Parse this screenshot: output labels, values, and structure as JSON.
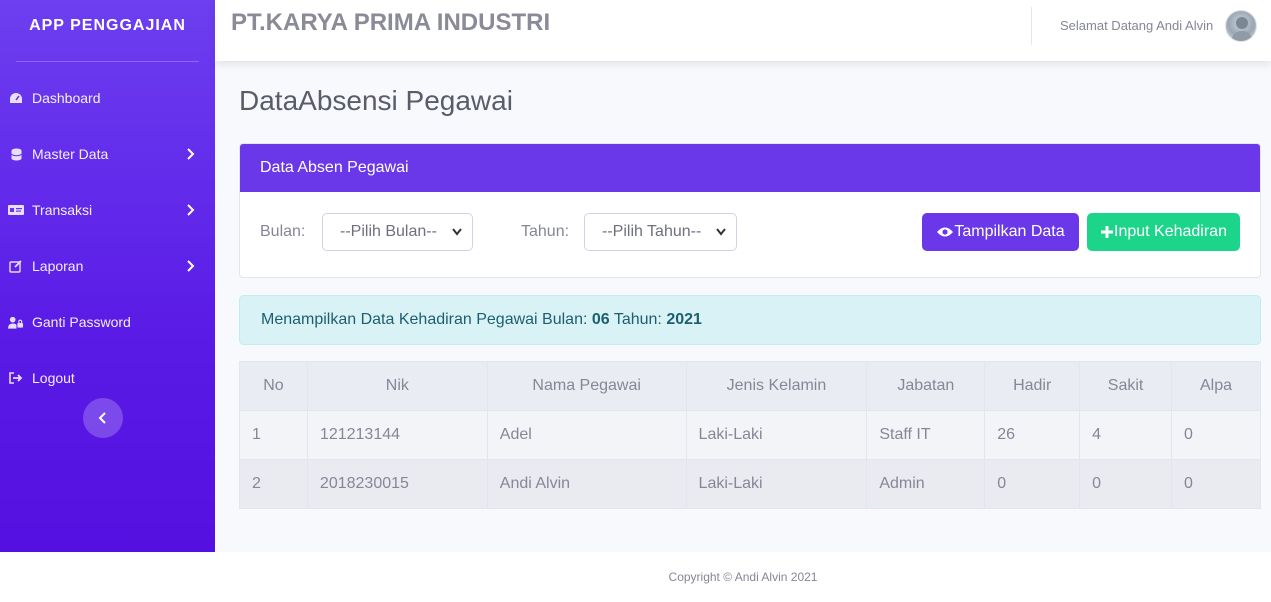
{
  "sidebar": {
    "brand": "APP PENGGAJIAN",
    "items": [
      {
        "label": "Dashboard",
        "icon": "tachometer-icon"
      },
      {
        "label": "Master Data",
        "icon": "database-icon"
      },
      {
        "label": "Transaksi",
        "icon": "id-card-icon"
      },
      {
        "label": "Laporan",
        "icon": "edit-icon"
      },
      {
        "label": "Ganti Password",
        "icon": "user-lock-icon"
      },
      {
        "label": "Logout",
        "icon": "sign-out-icon"
      }
    ]
  },
  "topbar": {
    "company": "PT.KARYA PRIMA INDUSTRI",
    "welcome": "Selamat Datang Andi Alvin"
  },
  "page": {
    "title": "DataAbsensi Pegawai"
  },
  "filter_card": {
    "header": "Data Absen Pegawai",
    "bulan_label": "Bulan:",
    "bulan_value": "--Pilih Bulan--",
    "tahun_label": "Tahun:",
    "tahun_value": "--Pilih Tahun--",
    "show_button": "Tampilkan Data",
    "input_button": "Input Kehadiran"
  },
  "alert": {
    "prefix": "Menampilkan Data Kehadiran Pegawai Bulan: ",
    "bulan": "06",
    "middle": " Tahun: ",
    "tahun": "2021"
  },
  "table": {
    "headers": [
      "No",
      "Nik",
      "Nama Pegawai",
      "Jenis Kelamin",
      "Jabatan",
      "Hadir",
      "Sakit",
      "Alpa"
    ],
    "rows": [
      [
        "1",
        "121213144",
        "Adel",
        "Laki-Laki",
        "Staff IT",
        "26",
        "4",
        "0"
      ],
      [
        "2",
        "2018230015",
        "Andi Alvin",
        "Laki-Laki",
        "Admin",
        "0",
        "0",
        "0"
      ]
    ]
  },
  "footer": {
    "text": "Copyright © Andi Alvin 2021"
  },
  "colors": {
    "primary": "#6a38e8",
    "success": "#1cd48a",
    "info_bg": "#d9f2f6"
  }
}
